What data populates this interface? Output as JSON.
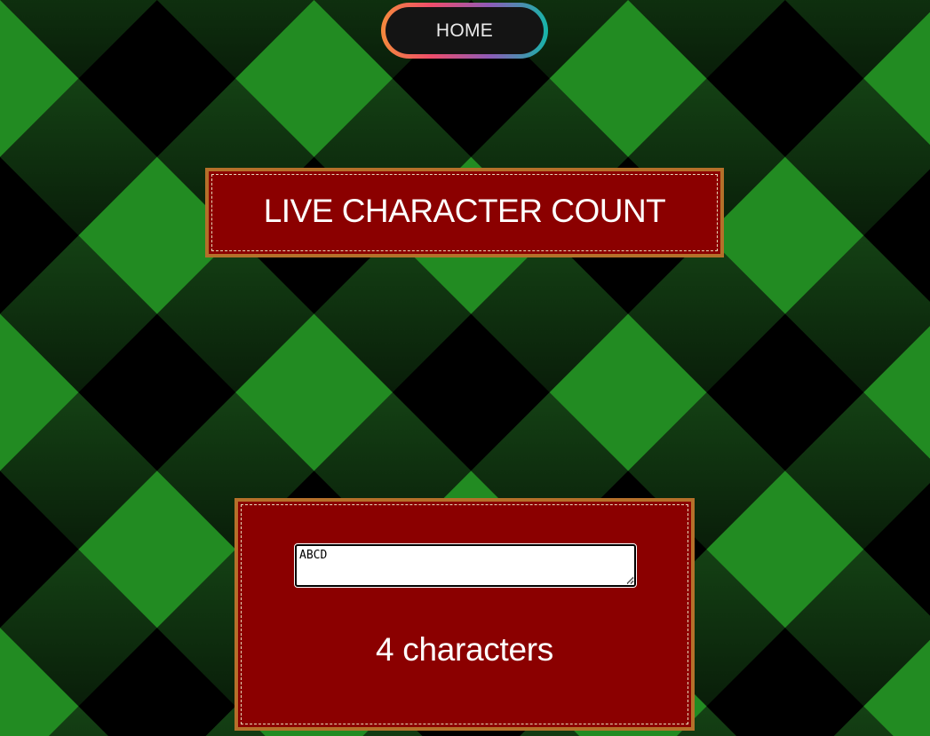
{
  "nav": {
    "home_label": "HOME"
  },
  "title": {
    "text": "LIVE CHARACTER COUNT"
  },
  "counter": {
    "input_value": "ABCD",
    "count_text": "4 characters"
  },
  "colors": {
    "panel_bg": "#8b0000",
    "panel_border": "#b5702a",
    "plaid_green": "#228b22",
    "plaid_dark_green": "#134713",
    "home_button_bg": "#141414"
  }
}
